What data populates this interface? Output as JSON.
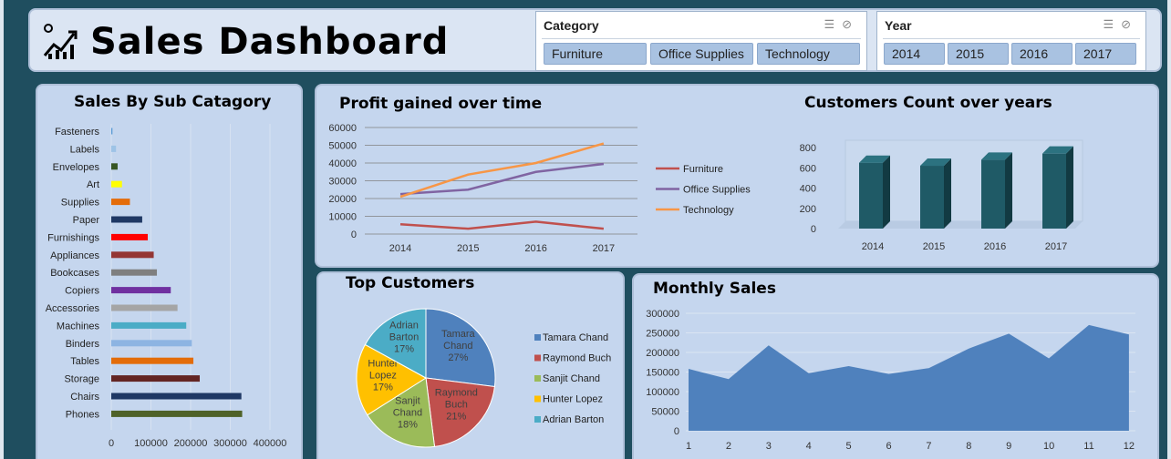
{
  "header": {
    "title": "Sales Dashboard",
    "logo_icon": "chart-growth-icon"
  },
  "slicers": {
    "category": {
      "title": "Category",
      "items": [
        "Furniture",
        "Office Supplies",
        "Technology"
      ]
    },
    "year": {
      "title": "Year",
      "items": [
        "2014",
        "2015",
        "2016",
        "2017"
      ]
    }
  },
  "panels": {
    "sub_category": "Sales By Sub Catagory",
    "profit": "Profit gained over time",
    "customers_count": "Customers Count over years",
    "top_customers": "Top Customers",
    "monthly": "Monthly Sales"
  },
  "chart_data": [
    {
      "id": "sub_category",
      "type": "bar",
      "orientation": "horizontal",
      "title": "Sales By Sub Catagory",
      "categories": [
        "Fasteners",
        "Labels",
        "Envelopes",
        "Art",
        "Supplies",
        "Paper",
        "Furnishings",
        "Appliances",
        "Bookcases",
        "Copiers",
        "Accessories",
        "Machines",
        "Binders",
        "Tables",
        "Storage",
        "Chairs",
        "Phones"
      ],
      "values": [
        3000,
        12000,
        16000,
        27000,
        47000,
        78000,
        92000,
        107000,
        115000,
        150000,
        167000,
        189000,
        203000,
        207000,
        223000,
        328000,
        330000
      ],
      "colors": [
        "#5b9bd5",
        "#9dc3e6",
        "#375623",
        "#ffff00",
        "#e46c0a",
        "#1f3864",
        "#ff0000",
        "#943634",
        "#7f7f7f",
        "#7030a0",
        "#a5a5a5",
        "#4bacc6",
        "#8db4e2",
        "#e36c09",
        "#632523",
        "#1f3864",
        "#4f6228"
      ],
      "xticks": [
        "0",
        "100000",
        "200000",
        "300000",
        "400000"
      ],
      "xlim": [
        0,
        400000
      ],
      "grid": true
    },
    {
      "id": "profit",
      "type": "line",
      "title": "Profit gained over time",
      "x": [
        "2014",
        "2015",
        "2016",
        "2017"
      ],
      "series": [
        {
          "name": "Furniture",
          "values": [
            5500,
            3000,
            7000,
            3000
          ],
          "color": "#c0504d"
        },
        {
          "name": "Office Supplies",
          "values": [
            22500,
            25000,
            35000,
            39500
          ],
          "color": "#8064a2"
        },
        {
          "name": "Technology",
          "values": [
            21000,
            33500,
            40000,
            51000
          ],
          "color": "#f79646"
        }
      ],
      "ylim": [
        0,
        60000
      ],
      "yticks": [
        "60000",
        "50000",
        "40000",
        "30000",
        "20000",
        "10000",
        "0"
      ],
      "legend": "right",
      "grid": true
    },
    {
      "id": "customers_count",
      "type": "bar",
      "title": "Customers Count over years",
      "categories": [
        "2014",
        "2015",
        "2016",
        "2017"
      ],
      "values": [
        650,
        620,
        680,
        740
      ],
      "ylim": [
        0,
        800
      ],
      "yticks": [
        "800",
        "600",
        "400",
        "200",
        "0"
      ],
      "color": "#1f5a66",
      "style": "3d"
    },
    {
      "id": "top_customers",
      "type": "pie",
      "title": "Top Customers",
      "labels": [
        "Tamara Chand",
        "Raymond Buch",
        "Sanjit Chand",
        "Hunter Lopez",
        "Adrian Barton"
      ],
      "label_lines": [
        [
          "Tamara",
          "Chand"
        ],
        [
          "Raymond",
          "Buch"
        ],
        [
          "Sanjit",
          "Chand"
        ],
        [
          "Hunter",
          "Lopez"
        ],
        [
          "Adrian",
          "Barton"
        ]
      ],
      "values": [
        27,
        21,
        18,
        17,
        17
      ],
      "display": [
        "27%",
        "21%",
        "18%",
        "17%",
        "17%"
      ],
      "colors": [
        "#4f81bd",
        "#c0504d",
        "#9bbb59",
        "#ffc000",
        "#4bacc6"
      ],
      "legend": "right"
    },
    {
      "id": "monthly",
      "type": "area",
      "title": "Monthly Sales",
      "x": [
        "1",
        "2",
        "3",
        "4",
        "5",
        "6",
        "7",
        "8",
        "9",
        "10",
        "11",
        "12"
      ],
      "values": [
        158000,
        132000,
        218000,
        147000,
        165000,
        145000,
        160000,
        210000,
        248000,
        185000,
        270000,
        246000
      ],
      "ylim": [
        0,
        300000
      ],
      "yticks": [
        "300000",
        "250000",
        "200000",
        "150000",
        "100000",
        "50000",
        "0"
      ],
      "color": "#4f81bd",
      "grid": true
    }
  ]
}
